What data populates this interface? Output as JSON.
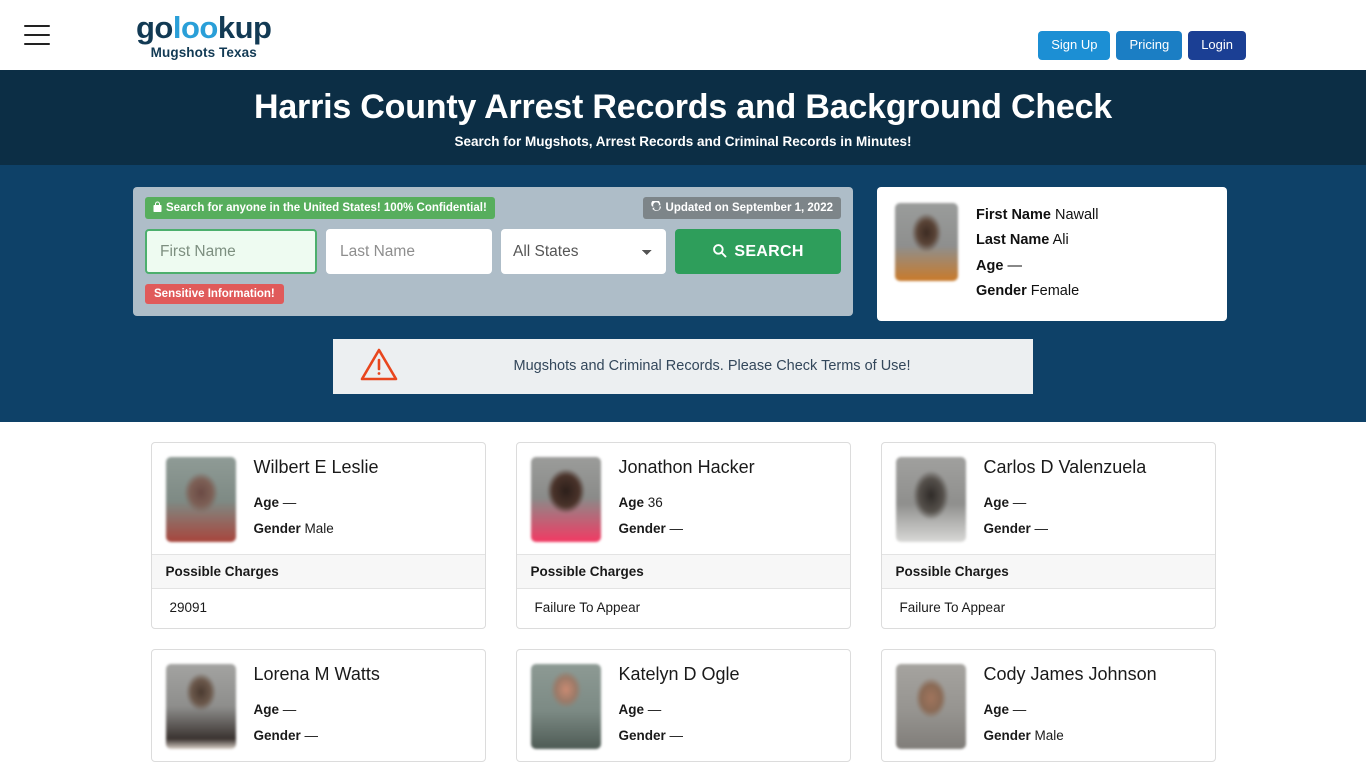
{
  "header": {
    "menu_icon": "hamburger-menu-icon",
    "logo": {
      "part1": "go",
      "part2": "loo",
      "part3": "kup",
      "tagline": "Mugshots Texas"
    },
    "buttons": {
      "signup": "Sign Up",
      "pricing": "Pricing",
      "login": "Login"
    },
    "colors": {
      "signup_bg": "#1c8fd4",
      "pricing_bg": "#1b7ec4",
      "login_bg": "#1b3f94"
    }
  },
  "banner": {
    "title": "Harris County Arrest Records and Background Check",
    "subtitle": "Search for Mugshots, Arrest Records and Criminal Records in Minutes!",
    "bg": "#0c2e45"
  },
  "hero": {
    "bg": "#0e4168"
  },
  "search": {
    "confidential_badge": "Search for anyone in the United States! 100% Confidential!",
    "confidential_icon": "lock-icon",
    "updated_badge": "Updated on September 1, 2022",
    "updated_icon": "refresh-icon",
    "first_name_placeholder": "First Name",
    "first_name_value": "",
    "last_name_placeholder": "Last Name",
    "last_name_value": "",
    "state_selected": "All States",
    "state_options": [
      "All States"
    ],
    "search_button": "SEARCH",
    "search_icon": "search-icon",
    "sensitive_badge": "Sensitive Information!",
    "colors": {
      "panel_bg": "#aebdc8",
      "green": "#2e9e5b",
      "red": "#e05a5a",
      "badge_green": "#57ae5d",
      "badge_gray": "#7d8589"
    }
  },
  "profile": {
    "avatar": "blurred-mugshot-thumbnail",
    "rows": [
      {
        "label": "First Name",
        "value": "Nawall"
      },
      {
        "label": "Last Name",
        "value": "Ali"
      },
      {
        "label": "Age",
        "value": "—"
      },
      {
        "label": "Gender",
        "value": "Female"
      }
    ]
  },
  "warning": {
    "icon": "warning-triangle-icon",
    "text": "Mugshots and Criminal Records. Please Check Terms of Use!",
    "bg": "#eceff1",
    "icon_color": "#e8461e"
  },
  "results": {
    "charges_header": "Possible Charges",
    "cards": [
      {
        "name": "Wilbert E Leslie",
        "age_label": "Age",
        "age": "—",
        "gender_label": "Gender",
        "gender": "Male",
        "charge": "29091",
        "thumb": "t1"
      },
      {
        "name": "Jonathon Hacker",
        "age_label": "Age",
        "age": "36",
        "gender_label": "Gender",
        "gender": "—",
        "charge": "Failure To Appear",
        "thumb": "t2"
      },
      {
        "name": "Carlos D Valenzuela",
        "age_label": "Age",
        "age": "—",
        "gender_label": "Gender",
        "gender": "—",
        "charge": "Failure To Appear",
        "thumb": "t3"
      },
      {
        "name": "Lorena M Watts",
        "age_label": "Age",
        "age": "—",
        "gender_label": "Gender",
        "gender": "—",
        "charge": "",
        "thumb": "t4"
      },
      {
        "name": "Katelyn D Ogle",
        "age_label": "Age",
        "age": "—",
        "gender_label": "Gender",
        "gender": "—",
        "charge": "",
        "thumb": "t5"
      },
      {
        "name": "Cody James Johnson",
        "age_label": "Age",
        "age": "—",
        "gender_label": "Gender",
        "gender": "Male",
        "charge": "",
        "thumb": "t6"
      }
    ]
  }
}
